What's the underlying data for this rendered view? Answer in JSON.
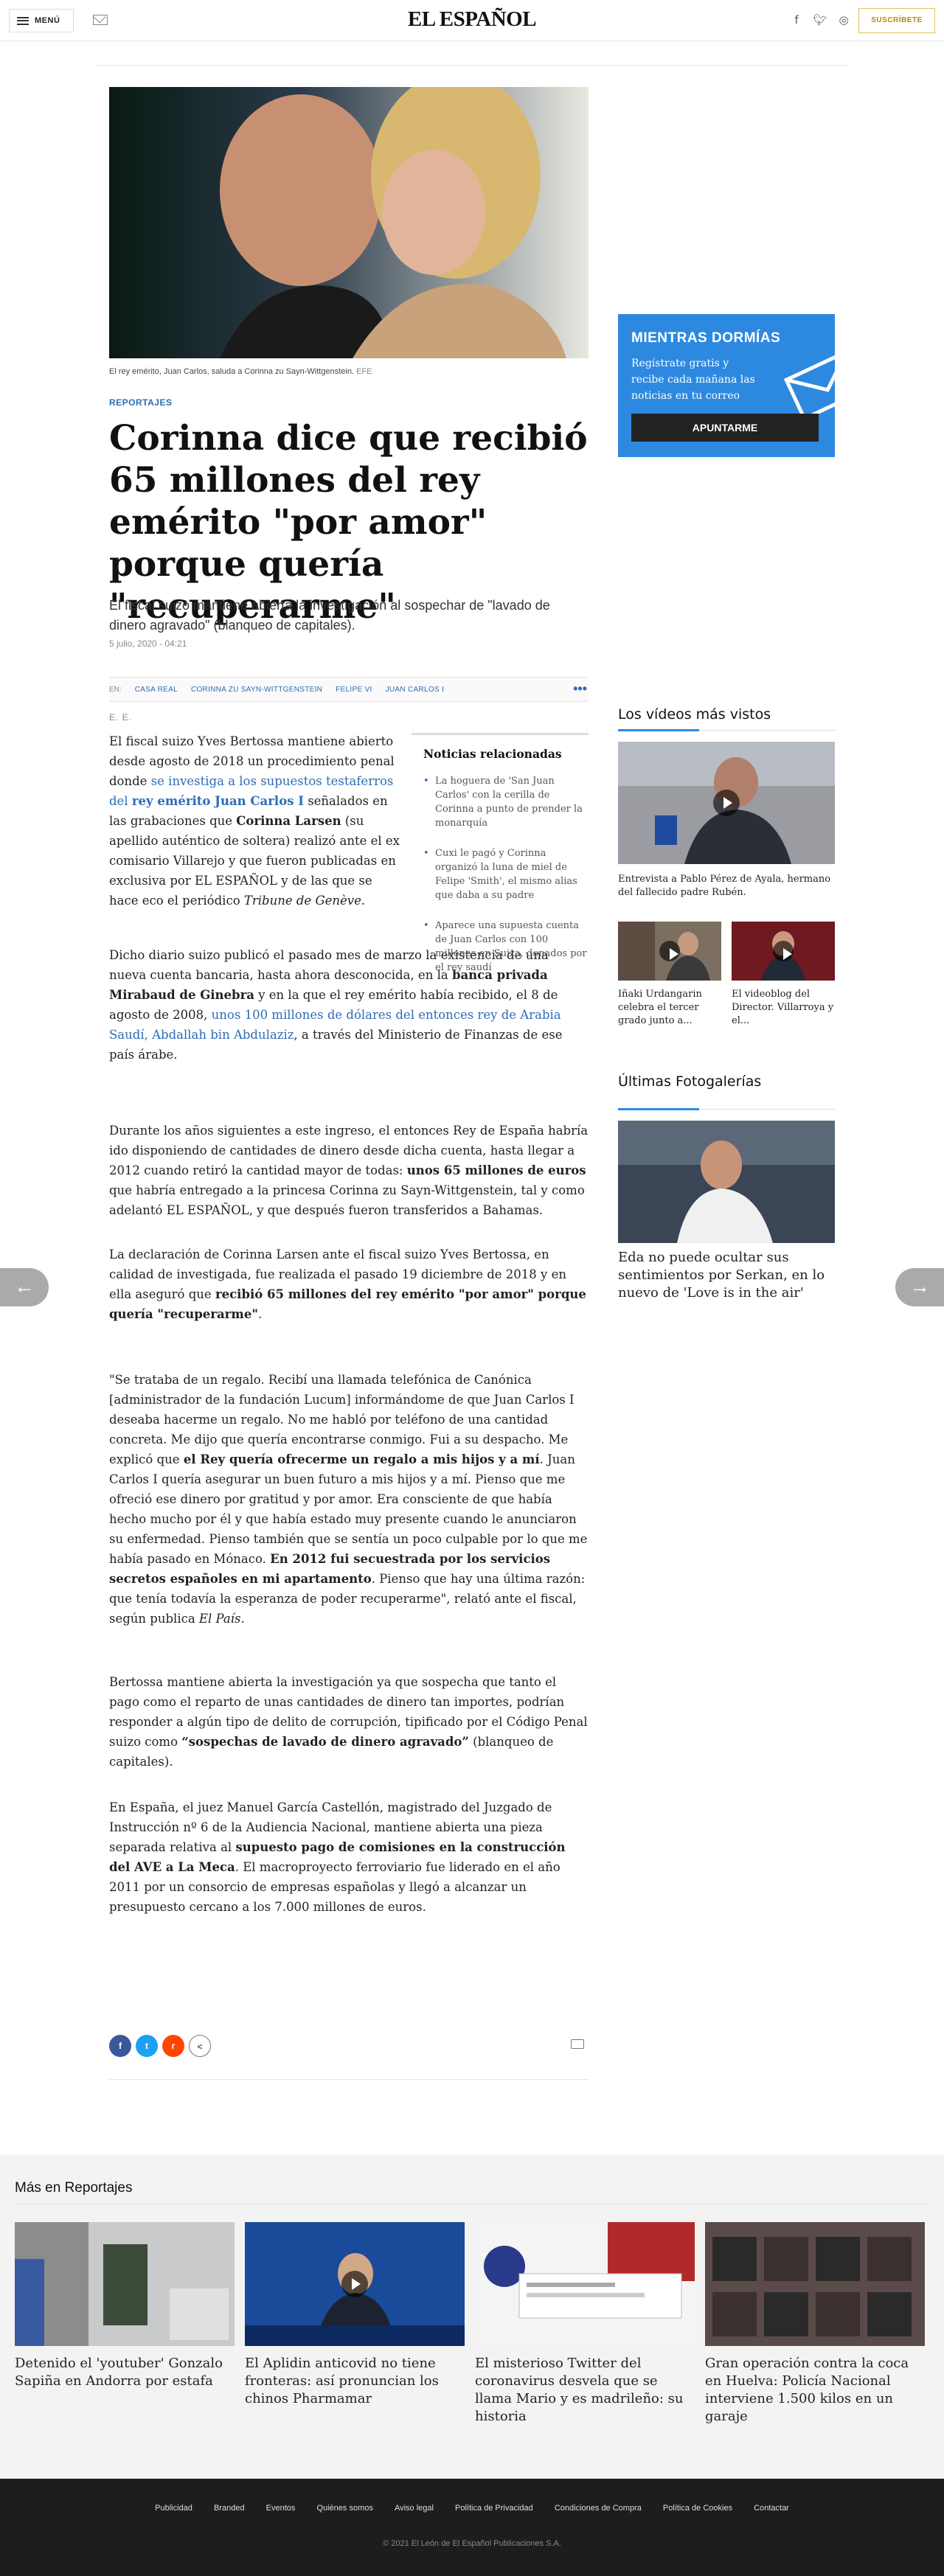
{
  "header": {
    "menu_label": "MENÚ",
    "logo": "EL ESPAÑOL",
    "subscribe_label": "SUSCRÍBETE",
    "social": [
      "f",
      "t",
      "ig"
    ]
  },
  "article": {
    "caption": "El rey emérito, Juan Carlos, saluda a Corinna zu Sayn-Wittgenstein.",
    "caption_credit": "EFE",
    "section": "REPORTAJES",
    "title": "Corinna dice que recibió 65 millones del rey emérito \"por amor\" porque quería \"recuperarme\"",
    "subtitle": "El fiscal suizo mantiene abierta la investigación al sospechar de \"lavado de dinero agravado\" (blanqueo de capitales).",
    "date": "5 julio, 2020 - 04:21",
    "tags_prefix": "EN:",
    "tags": [
      "CASA REAL",
      "CORINNA ZU SAYN-WITTGENSTEIN",
      "FELIPE VI",
      "JUAN CARLOS I"
    ],
    "byline": "E. E.",
    "p1": {
      "a": "El fiscal suizo Yves Bertossa mantiene abierto desde agosto de 2018 un procedimiento penal donde ",
      "link1": "se investiga a los supuestos testaferros del ",
      "link1b": "rey emérito Juan Carlos I",
      "b": " señalados en las grabaciones que ",
      "bold1": "Corinna Larsen",
      "c": " (su apellido auténtico de soltera) realizó ante el ex comisario Villarejo y que fueron publicadas en exclusiva por EL ESPAÑOL y de las que se hace eco el periódico ",
      "ital": "Tribune de Genève",
      "d": "."
    },
    "p2": {
      "a": "Dicho diario suizo publicó el pasado mes de marzo la existencia de una nueva cuenta bancaria, hasta ahora desconocida, en la ",
      "bold": "banca privada Mirabaud de Ginebra",
      "b": " y en la que el rey emérito había recibido, el 8 de agosto de 2008, ",
      "link": "unos 100 millones de dólares del entonces rey de Arabia Saudí, Abdallah bin Abdulaziz",
      "c": ", a través del Ministerio de Finanzas de ese país árabe."
    },
    "p3": {
      "a": "Durante los años siguientes a este ingreso, el entonces Rey de España habría ido disponiendo de cantidades de dinero desde dicha cuenta, hasta llegar a 2012 cuando retiró la cantidad mayor de todas: ",
      "bold": "unos 65 millones de euros",
      "b": " que habría entregado a la princesa Corinna zu Sayn-Wittgenstein, tal y como adelantó EL ESPAÑOL, y que después fueron transferidos a Bahamas."
    },
    "p4": {
      "a": "La declaración de Corinna Larsen ante el fiscal suizo Yves Bertossa, en calidad de investigada, fue realizada el pasado 19 diciembre de 2018 y en ella aseguró que ",
      "bold": "recibió 65 millones del rey emérito \"por amor\" porque quería \"recuperarme\"",
      "b": "."
    },
    "p5": {
      "a": "\"Se trataba de un regalo. Recibí una llamada telefónica de Canónica [administrador de la fundación Lucum] informándome de que Juan Carlos I deseaba hacerme un regalo. No me habló por teléfono de una cantidad concreta. Me dijo que quería encontrarse conmigo. Fui a su despacho. Me explicó que ",
      "bold1": "el Rey quería ofrecerme un regalo a mis hijos y a mí",
      "b": ". Juan Carlos I quería asegurar un buen futuro a mis hijos y a mí. Pienso que me ofreció ese dinero por gratitud y por amor. Era consciente de que había hecho mucho por él y que había estado muy presente cuando le anunciaron su enfermedad. Pienso también que se sentía un poco culpable por lo que me había pasado en Mónaco. ",
      "bold2": "En 2012 fui secuestrada por los servicios secretos españoles en mi apartamento",
      "c": ". Pienso que hay una última razón: que tenía todavía la esperanza de poder recuperarme\", relató ante el fiscal, según publica ",
      "ital": "El País",
      "d": "."
    },
    "p6": {
      "a": "Bertossa mantiene abierta la investigación ya que sospecha que tanto el pago como el reparto de unas cantidades de dinero tan importes, podrían responder a algún tipo de delito de corrupción, tipificado por el Código Penal suizo como ",
      "bold": "“sospechas de lavado de dinero agravado”",
      "b": " (blanqueo de capitales)."
    },
    "p7": {
      "a": "En España, el juez Manuel García Castellón, magistrado del Juzgado de Instrucción nº 6 de la Audiencia Nacional, mantiene abierta una pieza separada relativa al ",
      "bold": "supuesto pago de comisiones en la construcción del AVE a La Meca",
      "b": ". El macroproyecto ferroviario fue liderado en el año 2011 por un consorcio de empresas españolas y llegó a alcanzar un presupuesto cercano a los 7.000 millones de euros."
    }
  },
  "related": {
    "title": "Noticias relacionadas",
    "items": [
      "La hoguera de 'San Juan Carlos' con la cerilla de Corinna a punto de prender la monarquía",
      "Cuxi le pagó y Corinna organizó la luna de miel de Felipe 'Smith', el mismo alias que daba a su padre",
      "Aparece una supuesta cuenta de Juan Carlos con 100 millones en Suiza, donados por el rey saudí"
    ]
  },
  "promo": {
    "title": "MIENTRAS DORMÍAS",
    "text": "Regístrate gratis y recibe cada mañana las noticias en tu correo",
    "button": "APUNTARME"
  },
  "videos": {
    "title": "Los vídeos más vistos",
    "main_caption": "Entrevista a Pablo Pérez de Ayala, hermano del fallecido padre Rubén.",
    "small": [
      "Iñaki Urdangarin celebra el tercer grado junto a...",
      "El videoblog del Director. Villarroya y el..."
    ]
  },
  "gallery": {
    "title": "Últimas Fotogalerías",
    "caption": "Eda no puede ocultar sus sentimientos por Serkan, en lo nuevo de 'Love is in the air'"
  },
  "share": {
    "buttons": [
      "f",
      "t",
      "r",
      "<"
    ]
  },
  "more": {
    "title": "Más en Reportajes",
    "items": [
      "Detenido el 'youtuber' Gonzalo Sapiña en Andorra por estafa",
      "El Aplidin anticovid no tiene fronteras: así pronuncian los chinos Pharmamar",
      "El misterioso Twitter del coronavirus desvela que se llama Mario y es madrileño: su historia",
      "Gran operación contra la coca en Huelva: Policía Nacional interviene 1.500 kilos en un garaje"
    ]
  },
  "footer": {
    "links": [
      "Publicidad",
      "Branded",
      "Eventos",
      "Quiénes somos",
      "Aviso legal",
      "Política de Privacidad",
      "Condiciones de Compra",
      "Política de Cookies",
      "Contactar"
    ],
    "copyright": "© 2021 El León de El Español Publicaciones S.A."
  }
}
